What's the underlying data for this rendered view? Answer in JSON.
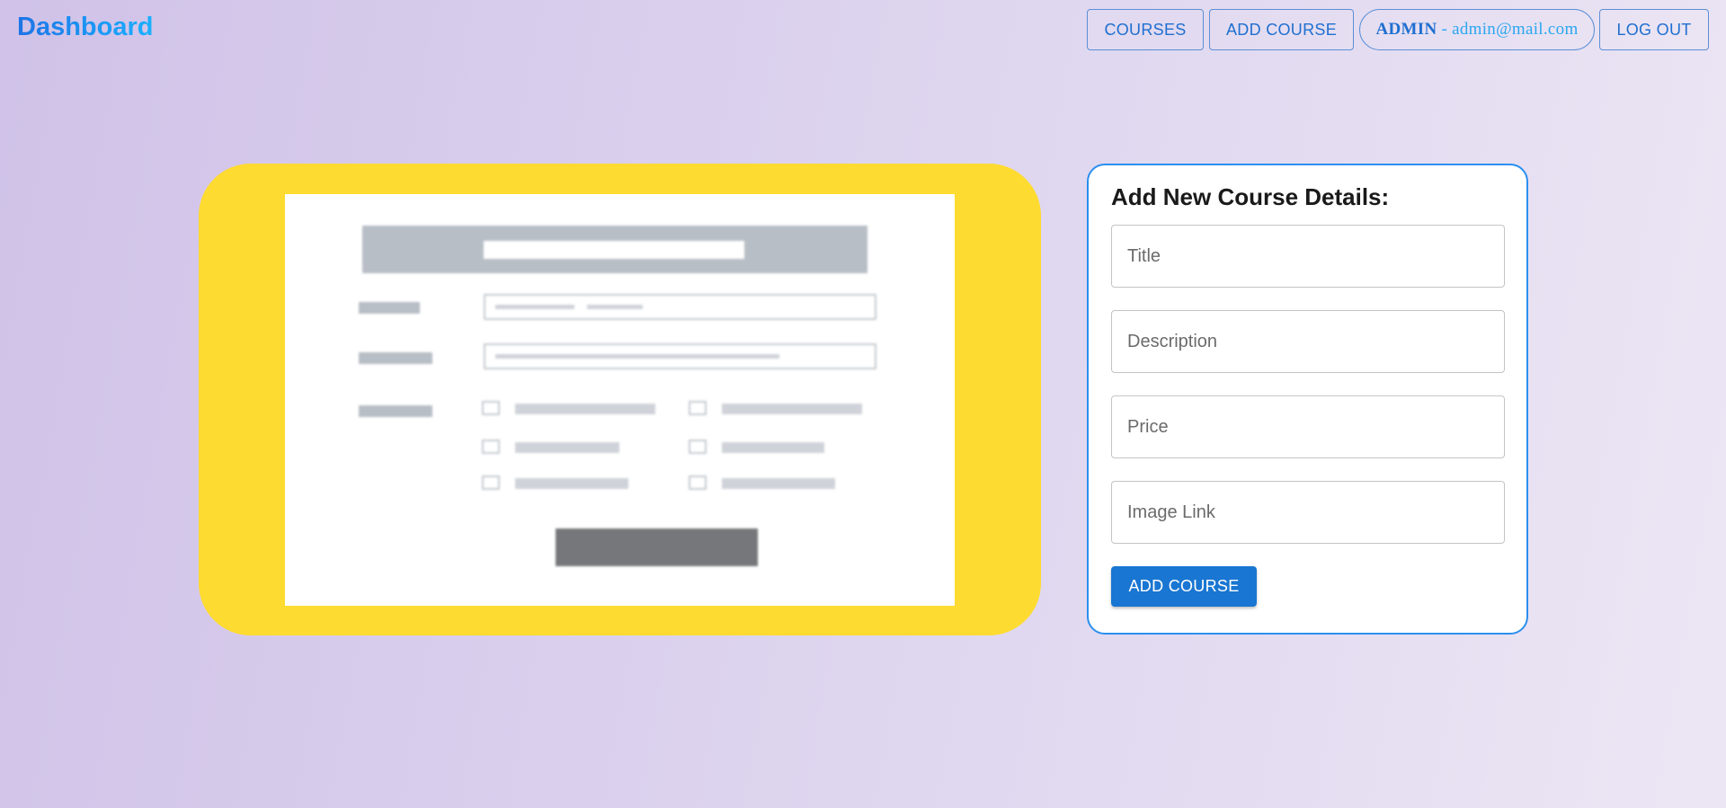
{
  "header": {
    "brand": "Dashboard",
    "nav": {
      "courses": "COURSES",
      "add_course": "ADD COURSE",
      "admin_role": "ADMIN",
      "admin_separator": "-",
      "admin_email": "admin@mail.com",
      "logout": "LOG OUT"
    }
  },
  "illustration": {
    "icon": "blurred-form-illustration",
    "background_color": "#fedb30"
  },
  "form": {
    "title": "Add New Course Details:",
    "fields": {
      "title_placeholder": "Title",
      "description_placeholder": "Description",
      "price_placeholder": "Price",
      "image_link_placeholder": "Image Link"
    },
    "submit_label": "ADD COURSE",
    "accent_color": "#1976d2"
  }
}
